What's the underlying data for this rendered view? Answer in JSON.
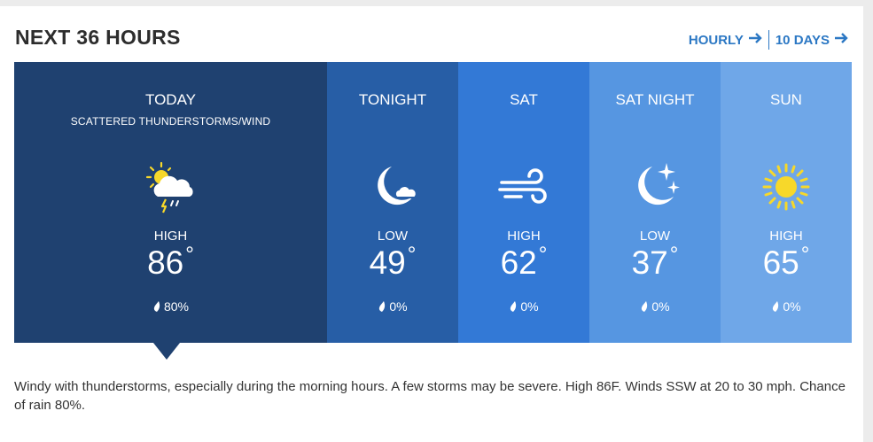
{
  "header": {
    "title": "NEXT 36 HOURS",
    "hourly_label": "HOURLY",
    "ten_days_label": "10 DAYS"
  },
  "periods": [
    {
      "name": "TODAY",
      "phrase": "SCATTERED THUNDERSTORMS/WIND",
      "icon": "thunderstorm-partly-sunny-icon",
      "temp_label": "HIGH",
      "temp": "86",
      "precip": "80%",
      "bg": "#1f4170"
    },
    {
      "name": "TONIGHT",
      "phrase": "",
      "icon": "moon-cloud-icon",
      "temp_label": "LOW",
      "temp": "49",
      "precip": "0%",
      "bg": "#275ea6"
    },
    {
      "name": "SAT",
      "phrase": "",
      "icon": "wind-icon",
      "temp_label": "HIGH",
      "temp": "62",
      "precip": "0%",
      "bg": "#3379d6"
    },
    {
      "name": "SAT NIGHT",
      "phrase": "",
      "icon": "moon-stars-icon",
      "temp_label": "LOW",
      "temp": "37",
      "precip": "0%",
      "bg": "#5696e1"
    },
    {
      "name": "SUN",
      "phrase": "",
      "icon": "sun-icon",
      "temp_label": "HIGH",
      "temp": "65",
      "precip": "0%",
      "bg": "#6fa7e8"
    }
  ],
  "description": "Windy with thunderstorms, especially during the morning hours. A few storms may be severe. High 86F. Winds SSW at 20 to 30 mph. Chance of rain 80%.",
  "colors": {
    "accent": "#2c78c4",
    "sun": "#f7d82a"
  }
}
